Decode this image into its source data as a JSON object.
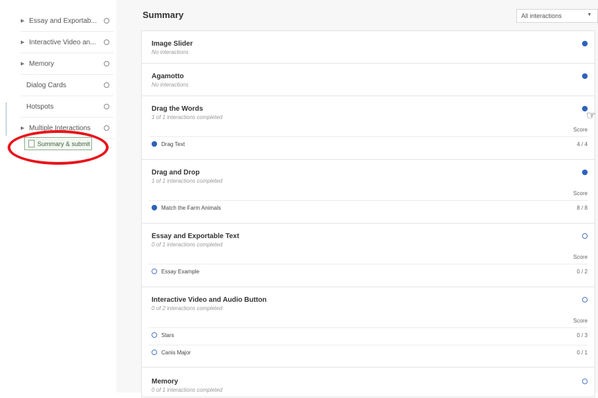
{
  "sidebar": {
    "items": [
      {
        "label": "Essay and Exportab..."
      },
      {
        "label": "Interactive Video an..."
      },
      {
        "label": "Memory"
      },
      {
        "label": "Dialog Cards"
      },
      {
        "label": "Hotspots"
      },
      {
        "label": "Multiple Interactions"
      }
    ],
    "submit_label": "Summary & submit"
  },
  "main": {
    "title": "Summary",
    "filter": {
      "selected": "All interactions"
    },
    "score_label": "Score",
    "sections": [
      {
        "title": "Image Slider",
        "subtitle": "No interactions"
      },
      {
        "title": "Agamotto",
        "subtitle": "No interactions"
      },
      {
        "title": "Drag the Words",
        "subtitle": "1 of 1 interactions completed",
        "rows": [
          {
            "label": "Drag Text",
            "score": "4 / 4"
          }
        ]
      },
      {
        "title": "Drag and Drop",
        "subtitle": "1 of 1 interactions completed",
        "rows": [
          {
            "label": "Match the Farm Animals",
            "score": "8 / 8"
          }
        ]
      },
      {
        "title": "Essay and Exportable Text",
        "subtitle": "0 of 1 interactions completed",
        "rows": [
          {
            "label": "Essay Example",
            "score": "0 / 2"
          }
        ]
      },
      {
        "title": "Interactive Video and Audio Button",
        "subtitle": "0 of 2 interactions completed",
        "rows": [
          {
            "label": "Stars",
            "score": "0 / 3"
          },
          {
            "label": "Canis Major",
            "score": "0 / 1"
          }
        ]
      },
      {
        "title": "Memory",
        "subtitle": "0 of 1 interactions completed"
      }
    ]
  },
  "colors": {
    "accent": "#2c63b8",
    "highlight": "#e8141b"
  }
}
